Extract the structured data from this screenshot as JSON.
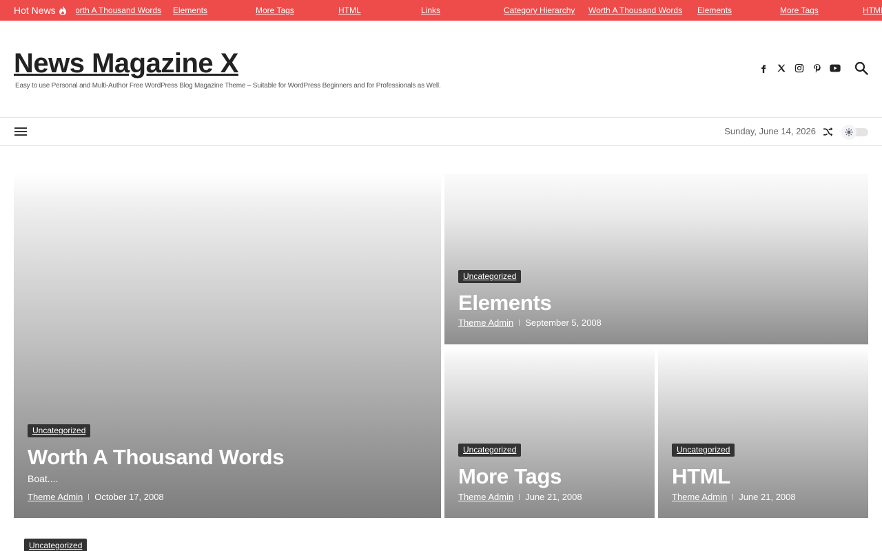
{
  "ticker": {
    "label": "Hot News",
    "items": [
      {
        "text": "Worth A Thousand Words",
        "left": 0
      },
      {
        "text": "Elements"
      },
      {
        "text": "More Tags"
      },
      {
        "text": "HTML"
      },
      {
        "text": "Links"
      },
      {
        "text": "Category Hierarchy"
      },
      {
        "text": "Worth A Thousand Words"
      },
      {
        "text": "Elements"
      },
      {
        "text": "More Tags"
      },
      {
        "text": "HTML"
      }
    ]
  },
  "header": {
    "site_title": "News Magazine X",
    "tagline": "Easy to use Personal and Multi-Author Free WordPress Blog Magazine Theme – Suitable for WordPress Beginners and for Professionals as Well.",
    "social": [
      "facebook-icon",
      "x-icon",
      "instagram-icon",
      "pinterest-icon",
      "youtube-icon"
    ]
  },
  "nav": {
    "date": "Sunday, June 14, 2026"
  },
  "posts": [
    {
      "category": "Uncategorized",
      "title": "Worth A Thousand Words",
      "excerpt": "Boat....",
      "author": "Theme Admin",
      "date": "October 17, 2008"
    },
    {
      "category": "Uncategorized",
      "title": "Elements",
      "author": "Theme Admin",
      "date": "September 5, 2008"
    },
    {
      "category": "Uncategorized",
      "title": "More Tags",
      "author": "Theme Admin",
      "date": "June 21, 2008"
    },
    {
      "category": "Uncategorized",
      "title": "HTML",
      "author": "Theme Admin",
      "date": "June 21, 2008"
    }
  ],
  "bottom": {
    "category": "Uncategorized"
  },
  "colors": {
    "ticker_bg": "#ee4b4b",
    "category_bg": "#333333"
  }
}
